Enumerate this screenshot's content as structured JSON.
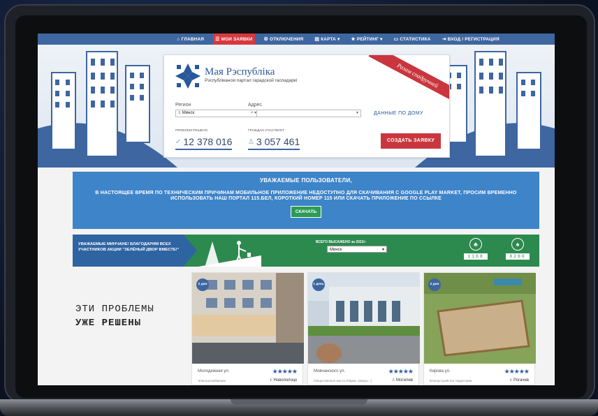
{
  "nav": {
    "items": [
      {
        "icon": "home-icon",
        "glyph": "⌂",
        "label": "ГЛАВНАЯ"
      },
      {
        "icon": "list-icon",
        "glyph": "☰",
        "label": "МОИ ЗАЯВКИ"
      },
      {
        "icon": "outage-icon",
        "glyph": "⚙",
        "label": "ОТКЛЮЧЕНИЯ"
      },
      {
        "icon": "map-icon",
        "glyph": "▤",
        "label": "КАРТА ▾"
      },
      {
        "icon": "star-icon",
        "glyph": "★",
        "label": "РЕЙТИНГ ▾"
      },
      {
        "icon": "chart-icon",
        "glyph": "▭",
        "label": "СТАТИСТИКА"
      },
      {
        "icon": "login-icon",
        "glyph": "⇥",
        "label": "ВХОД / РЕГИСТРАЦИЯ"
      }
    ]
  },
  "brand": {
    "title": "Мая Рэспубліка",
    "subtitle": "Рэспубліканскі партал гарадской гаспадаркі",
    "ribbon": "Разам спадручней"
  },
  "form": {
    "region_label": "Регион",
    "address_label": "Адрес",
    "region_value": "г. Минск",
    "region_controls": "× ▾",
    "address_controls": "▾",
    "house_link": "ДАННЫЕ ПО ДОМУ",
    "create_button": "СОЗДАТЬ ЗАЯВКУ"
  },
  "stats": {
    "solved_label": "ПРОБЛЕМ РЕШЕНО",
    "solved_value": "12 378 016",
    "citizens_label": "ГРАЖДАН УЧАСТВУЕТ",
    "citizens_value": "3 057 461"
  },
  "notice": {
    "title": "УВАЖАЕМЫЕ ПОЛЬЗОВАТЕЛИ,",
    "body": "В НАСТОЯЩЕЕ ВРЕМЯ ПО ТЕХНИЧЕСКИМ ПРИЧИНАМ МОБИЛЬНОЕ ПРИЛОЖЕНИЕ НЕДОСТУПНО ДЛЯ СКАЧИВАНИЯ С GOOGLE PLAY MARKET, ПРОСИМ ВРЕМЕННО ИСПОЛЬЗОВАТЬ НАШ ПОРТАЛ 115.БЕЛ, КОРОТКИЙ НОМЕР 115 ИЛИ СКАЧАТЬ ПРИЛОЖЕНИЕ ПО ССЫЛКЕ",
    "button": "СКАЧАТЬ"
  },
  "campaign": {
    "text": "УВАЖАЕМЫЕ МИНЧАНЕ! БЛАГОДАРИМ ВСЕХ УЧАСТНИКОВ АКЦИИ \"ЗЕЛЁНЫЙ ДВОР ВМЕСТЕ!\"",
    "total_label": "ВСЕГО ВЫСАЖЕНО за 2022г:",
    "city_value": "Минск",
    "badge1_value": "1168",
    "badge2_value": "8260"
  },
  "solved": {
    "title_line1": "ЭТИ ПРОБЛЕМЫ",
    "title_line2": "УЖЕ РЕШЕНЫ",
    "cards": [
      {
        "days": "2 дня",
        "street": "Молодежная ул.",
        "category": "Электроснабжение",
        "stars": "★★★★★",
        "town": "г. Новополоцк"
      },
      {
        "days": "1 день",
        "street": "Мовчанского ул.",
        "category": "Общественное место (Парки, скверы...)",
        "stars": "★★★★★",
        "town": "г. Могилев"
      },
      {
        "days": "2 дня",
        "street": "Кирова ул.",
        "category": "Благоустройство территории",
        "stars": "★★★★★",
        "town": "г. Рогачев"
      }
    ]
  }
}
